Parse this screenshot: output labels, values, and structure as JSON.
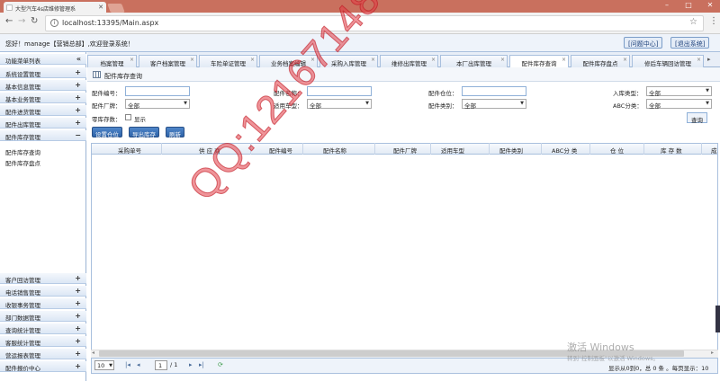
{
  "browser": {
    "tab_title": "大型汽车4s店维修管理系",
    "url": "localhost:13395/Main.aspx"
  },
  "header": {
    "welcome": "您好！manage【营销总部】,欢迎登录系统！",
    "help_label": "[问题中心]",
    "logout_label": "[退出系统]"
  },
  "sidebar": {
    "title": "功能菜单列表",
    "collapse_icon": "«",
    "top_items": [
      {
        "label": "系统设置管理",
        "sign": "+"
      },
      {
        "label": "基本信息管理",
        "sign": "+"
      },
      {
        "label": "基本业务管理",
        "sign": "+"
      },
      {
        "label": "配件进货管理",
        "sign": "+"
      },
      {
        "label": "配件出库管理",
        "sign": "+"
      },
      {
        "label": "配件库存管理",
        "sign": "−"
      }
    ],
    "sub_items": [
      "配件库存查询",
      "配件库存盘点"
    ],
    "bottom_items": [
      {
        "label": "客户回访管理",
        "sign": "+"
      },
      {
        "label": "电话销售管理",
        "sign": "+"
      },
      {
        "label": "收银事务管理",
        "sign": "+"
      },
      {
        "label": "部门数据管理",
        "sign": "+"
      },
      {
        "label": "查询统计管理",
        "sign": "+"
      },
      {
        "label": "客服统计管理",
        "sign": "+"
      },
      {
        "label": "营运报表管理",
        "sign": "+"
      },
      {
        "label": "配件报价中心",
        "sign": "+"
      }
    ]
  },
  "tabs": [
    "档案管理",
    "客户档案管理",
    "车险单证管理",
    "业务档案编辑",
    "采购入库管理",
    "维修出库管理",
    "本厂出库管理",
    "配件库存查询",
    "配件库存盘点",
    "修后车辆回访管理"
  ],
  "active_tab": "配件库存查询",
  "panel": {
    "title": "配件库存查询"
  },
  "form": {
    "part_no_label": "配件编号：",
    "part_name_label": "配件名称：",
    "location_label": "配件仓位：",
    "stock_type_label": "入库类型：",
    "stock_type_value": "全部",
    "maker_label": "配件厂牌：",
    "maker_value": "全部",
    "model_label": "适用车型：",
    "model_value": "全部",
    "category_label": "配件类别：",
    "category_value": "全部",
    "abc_label": "ABC分类：",
    "abc_value": "全部",
    "zero_label": "零库存数：",
    "show_label": "显示",
    "query_label": "查询"
  },
  "actions": {
    "set_location": "设置仓位",
    "export": "导出库存",
    "refresh": "刷新"
  },
  "grid": {
    "columns": [
      "采购单号",
      "供 应 商",
      "配件编号",
      "配件名称",
      "配件厂牌",
      "适用车型",
      "配件类别",
      "ABC分 类",
      "仓 位",
      "库 存 数",
      "成"
    ]
  },
  "pager": {
    "page_size": "10",
    "page": "1",
    "total_pages": "/ 1",
    "info": "显示从0到0，总 0 条 。每页显示：10"
  },
  "watermark": {
    "qq": "QQ:1216714825",
    "win_activate": "激活 Windows",
    "win_activate_sub": "转到\"控制面板\"以激活 Windows。"
  }
}
